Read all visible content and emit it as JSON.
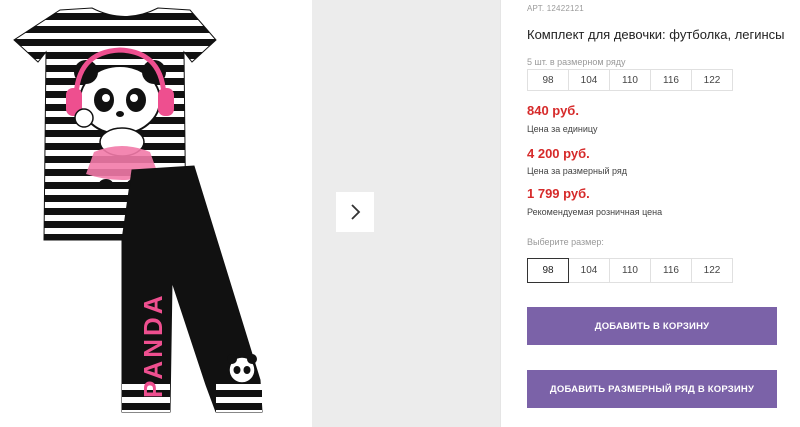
{
  "product": {
    "article": "АРТ. 12422121",
    "title": "Комплект для девочки: футболка, легинсы",
    "image_text": "PANDA"
  },
  "size_row": {
    "note": "5 шт. в размерном ряду",
    "sizes": [
      "98",
      "104",
      "110",
      "116",
      "122"
    ]
  },
  "prices": {
    "unit": {
      "value": "840 руб.",
      "label": "Цена за единицу"
    },
    "row": {
      "value": "4 200 руб.",
      "label": "Цена за размерный ряд"
    },
    "retail": {
      "value": "1 799 руб.",
      "label": "Рекомендуемая розничная цена"
    }
  },
  "size_picker": {
    "label": "Выберите размер:",
    "sizes": [
      "98",
      "104",
      "110",
      "116",
      "122"
    ],
    "selected": "98"
  },
  "buttons": {
    "add_to_cart": "ДОБАВИТЬ В КОРЗИНУ",
    "add_row_to_cart": "ДОБАВИТЬ РАЗМЕРНЫЙ РЯД В КОРЗИНУ"
  },
  "colors": {
    "price": "#d62a2a",
    "button": "#7b62a8",
    "gallery_bg": "#ececec"
  },
  "icons": {
    "next": "chevron-right-icon"
  }
}
